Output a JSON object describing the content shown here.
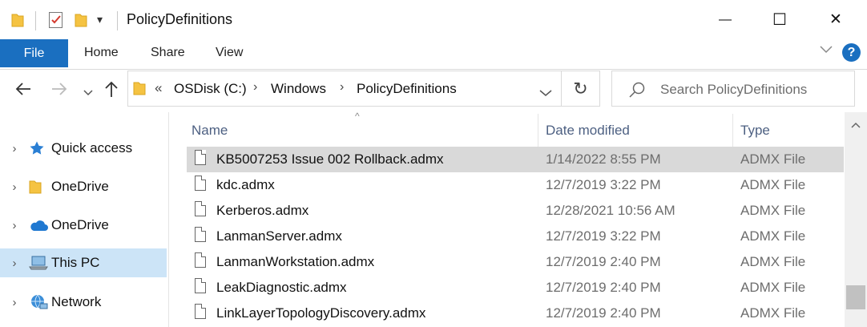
{
  "window": {
    "title": "PolicyDefinitions",
    "minimize": "—",
    "maximize": "☐",
    "close": "✕",
    "qat_dropdown": "▾"
  },
  "ribbon": {
    "tabs": [
      "File",
      "Home",
      "Share",
      "View"
    ],
    "expand": "⌵",
    "help": "?"
  },
  "nav": {
    "back": "←",
    "forward": "→",
    "recent": "⌄",
    "up": "↑",
    "overflow": "«",
    "breadcrumbs": [
      "OSDisk (C:)",
      "Windows",
      "PolicyDefinitions"
    ],
    "crumb_sep": "›",
    "history_dropdown": "⌄",
    "refresh": "↻"
  },
  "search": {
    "placeholder": "Search PolicyDefinitions"
  },
  "sidebar": {
    "items": [
      {
        "label": "Quick access",
        "icon": "star-icon",
        "selected": false
      },
      {
        "label": "OneDrive",
        "icon": "folder-icon",
        "selected": false
      },
      {
        "label": "OneDrive",
        "icon": "cloud-icon",
        "selected": false
      },
      {
        "label": "This PC",
        "icon": "computer-icon",
        "selected": true
      },
      {
        "label": "Network",
        "icon": "network-icon",
        "selected": false
      }
    ],
    "chevron": "›"
  },
  "list": {
    "columns": [
      "Name",
      "Date modified",
      "Type"
    ],
    "sort_indicator": "^",
    "rows": [
      {
        "name": "KB5007253 Issue 002 Rollback.admx",
        "date": "1/14/2022 8:55 PM",
        "type": "ADMX File",
        "selected": true
      },
      {
        "name": "kdc.admx",
        "date": "12/7/2019 3:22 PM",
        "type": "ADMX File",
        "selected": false
      },
      {
        "name": "Kerberos.admx",
        "date": "12/28/2021 10:56 AM",
        "type": "ADMX File",
        "selected": false
      },
      {
        "name": "LanmanServer.admx",
        "date": "12/7/2019 3:22 PM",
        "type": "ADMX File",
        "selected": false
      },
      {
        "name": "LanmanWorkstation.admx",
        "date": "12/7/2019 2:40 PM",
        "type": "ADMX File",
        "selected": false
      },
      {
        "name": "LeakDiagnostic.admx",
        "date": "12/7/2019 2:40 PM",
        "type": "ADMX File",
        "selected": false
      },
      {
        "name": "LinkLayerTopologyDiscovery.admx",
        "date": "12/7/2019 2:40 PM",
        "type": "ADMX File",
        "selected": false
      }
    ]
  },
  "colors": {
    "file_tab": "#1a6fc0",
    "selection_sidebar": "#cce4f7",
    "selection_row": "#d9d9d9",
    "help_badge": "#1a6fc0"
  }
}
